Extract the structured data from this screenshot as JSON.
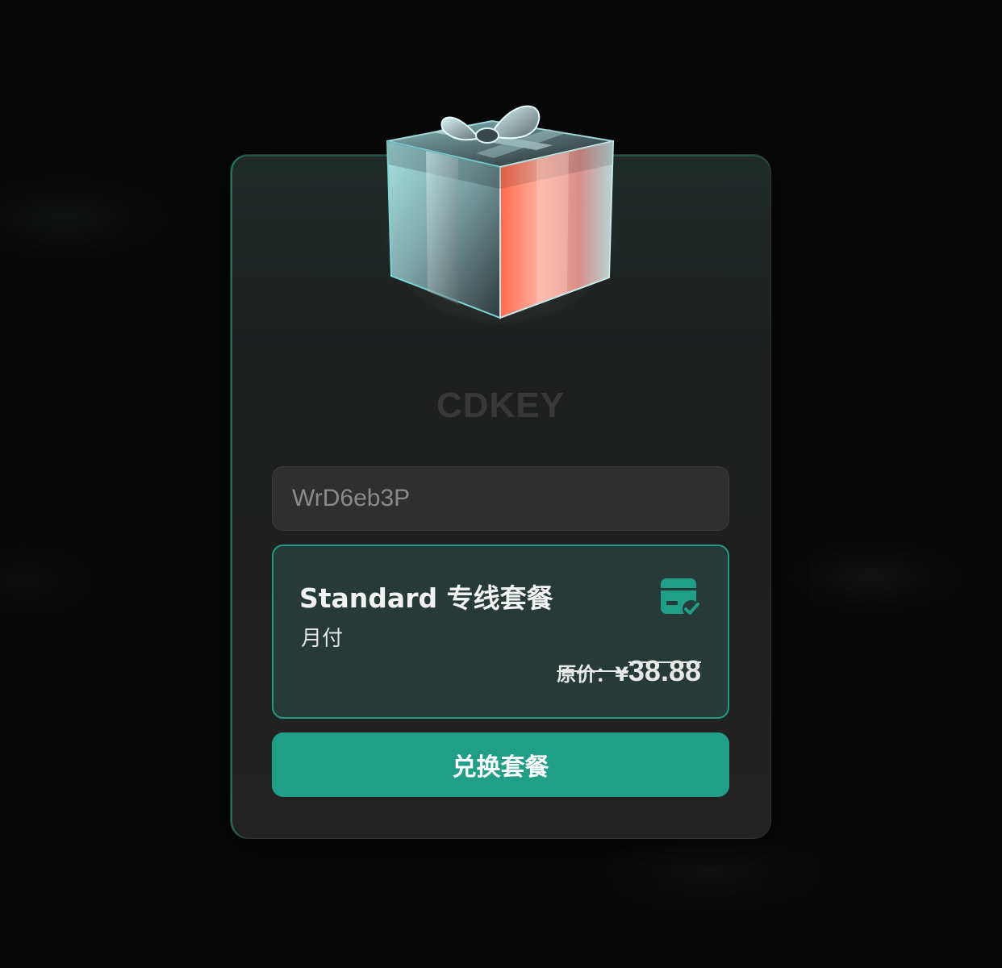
{
  "page": {
    "title": "CDKEY"
  },
  "code_input": {
    "value": "WrD6eb3P"
  },
  "plan": {
    "name": "Standard 专线套餐",
    "cycle": "月付",
    "original_price_label": "原价：¥",
    "original_price": "38.88",
    "icon": "box-check-icon"
  },
  "actions": {
    "redeem_label": "兑换套餐"
  },
  "colors": {
    "accent": "#209e86",
    "plan_card_bg": "#263a37",
    "page_bg": "#070707"
  }
}
